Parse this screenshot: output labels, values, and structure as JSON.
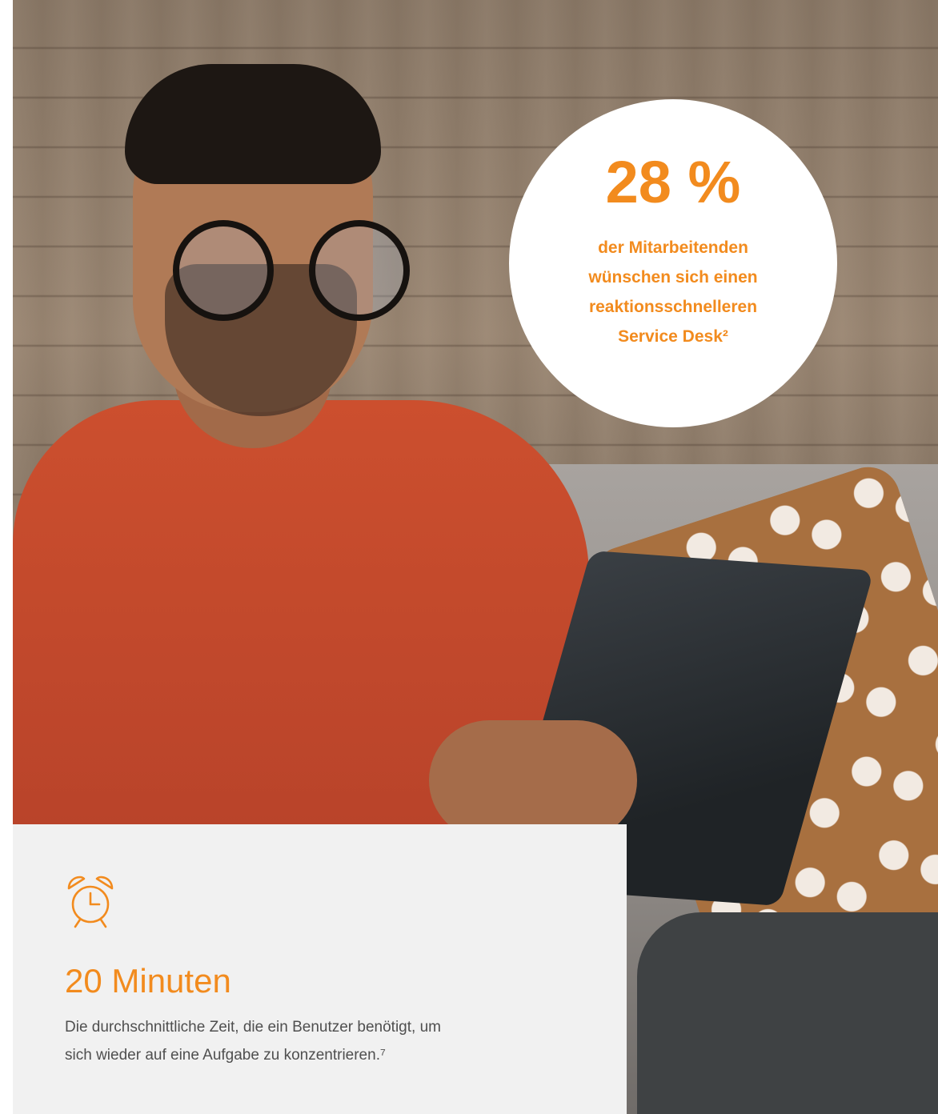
{
  "colors": {
    "accent": "#f28b1e",
    "card_bg": "#f1f1f1",
    "body_text": "#4f4f4f"
  },
  "photo": {
    "icon": "man-with-tablet-photo"
  },
  "highlight": {
    "value": "28 %",
    "lines": [
      "der Mitarbeitenden",
      "wünschen sich einen",
      "reaktionsschnelleren",
      "Service Desk²"
    ]
  },
  "card": {
    "icon": "alarm-clock-icon",
    "title": "20 Minuten",
    "text_lines": [
      "Die durchschnittliche Zeit, die ein Benutzer benötigt, um",
      "sich wieder auf eine Aufgabe zu konzentrieren.⁷"
    ]
  }
}
